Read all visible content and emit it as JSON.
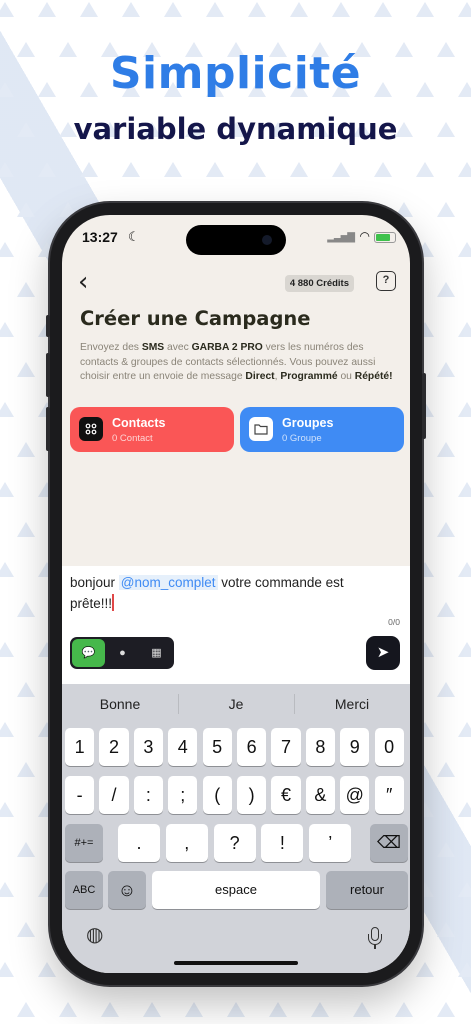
{
  "header": {
    "headline": "Simplicité",
    "subline": "variable dynamique"
  },
  "status_bar": {
    "time": "13:27",
    "moon_icon": "☾",
    "signal_icon": "▂▃▅▇",
    "wifi_icon": "◠",
    "battery_level": 0.75
  },
  "topbar": {
    "back_icon": "‹",
    "credits": "4 880 Crédits",
    "help_label": "?"
  },
  "page": {
    "title": "Créer une Campagne",
    "desc_1": "Envoyez des ",
    "desc_sms": "SMS",
    "desc_2": " avec ",
    "desc_brand": "GARBA 2 PRO",
    "desc_3": " vers les numéros des contacts & groupes de contacts sélectionnés. Vous pouvez aussi choisir entre un envoie de message ",
    "desc_direct": "Direct",
    "desc_4": ", ",
    "desc_prog": "Programmé",
    "desc_5": " ou ",
    "desc_rep": "Répété!"
  },
  "cards": {
    "contacts_title": "Contacts",
    "contacts_sub": "0 Contact",
    "groupes_title": "Groupes",
    "groupes_sub": "0 Groupe"
  },
  "composer": {
    "msg_part1": "bonjour ",
    "msg_var": "@nom_complet",
    "msg_part2": " votre commande est prête!!!",
    "counter": "0/0",
    "mode_icons": [
      "💬",
      "●",
      "▦"
    ],
    "send_icon": "➤"
  },
  "keyboard": {
    "suggestions": [
      "Bonne",
      "Je",
      "Merci"
    ],
    "row1": [
      "1",
      "2",
      "3",
      "4",
      "5",
      "6",
      "7",
      "8",
      "9",
      "0"
    ],
    "row2": [
      "-",
      "/",
      ":",
      ";",
      "(",
      ")",
      "€",
      "&",
      "@",
      "″"
    ],
    "row3_left": "#+=",
    "row3": [
      ".",
      ",",
      "?",
      "!",
      "’"
    ],
    "backspace_icon": "⌫",
    "abc": "ABC",
    "emoji_icon": "☺",
    "space": "espace",
    "return": "retour",
    "globe_icon": "◍"
  },
  "colors": {
    "accent_blue": "#2f7de6",
    "navy": "#14164a",
    "contacts_red": "#fa5656",
    "groupes_blue": "#3f8bf4",
    "active_green": "#46b84b"
  }
}
